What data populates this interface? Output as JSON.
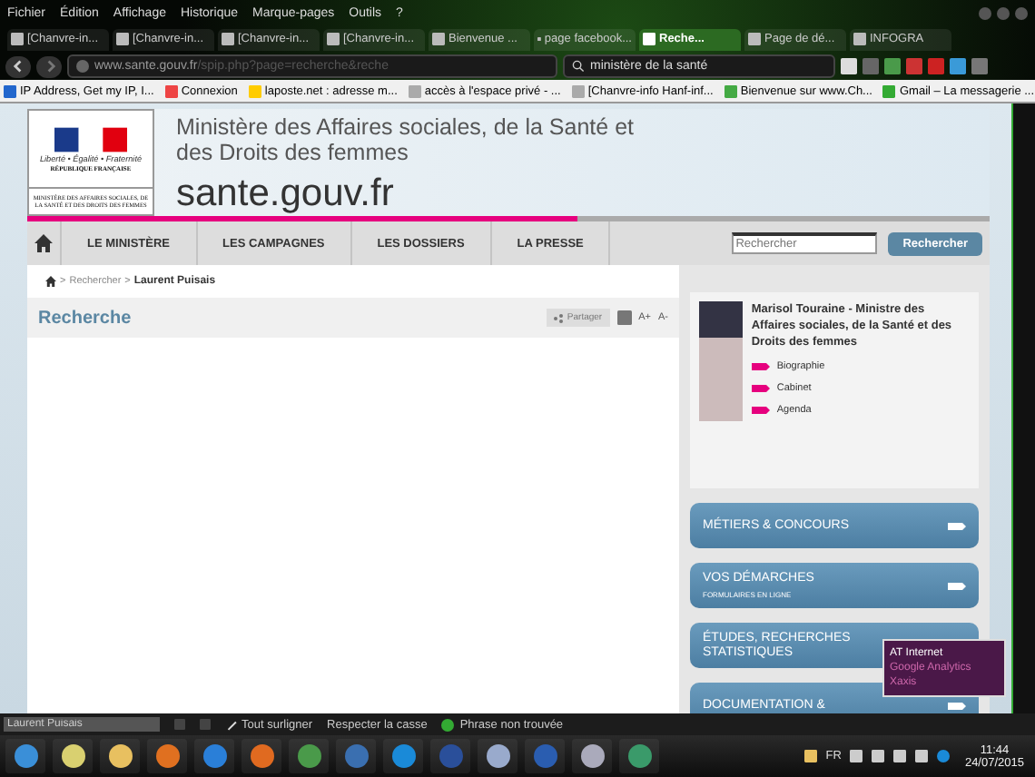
{
  "menu": [
    "Fichier",
    "Édition",
    "Affichage",
    "Historique",
    "Marque-pages",
    "Outils",
    "?"
  ],
  "tabs": [
    {
      "label": "[Chanvre-in...",
      "selected": false
    },
    {
      "label": "[Chanvre-in...",
      "selected": false
    },
    {
      "label": "[Chanvre-in...",
      "selected": false
    },
    {
      "label": "[Chanvre-in...",
      "selected": false
    },
    {
      "label": "Bienvenue ...",
      "selected": false
    },
    {
      "label": "page facebook...",
      "selected": false
    },
    {
      "label": "Reche...",
      "selected": true
    },
    {
      "label": "Page de dé...",
      "selected": false
    },
    {
      "label": "INFOGRA",
      "selected": false
    }
  ],
  "address": {
    "host": "www.sante.gouv.fr",
    "path": "/spip.php?page=recherche&reche"
  },
  "browser_search": {
    "value": "ministère de la santé"
  },
  "bookmarks": [
    "IP Address, Get my IP, I...",
    "Connexion",
    "laposte.net : adresse m...",
    "accès à l'espace privé - ...",
    "[Chanvre-info Hanf-inf...",
    "Bienvenue sur www.Ch...",
    "Gmail – La messagerie ..."
  ],
  "site": {
    "logo_lines": [
      "Liberté • Égalité • Fraternité",
      "RÉPUBLIQUE FRANÇAISE"
    ],
    "logo_ministry": "MINISTÈRE DES AFFAIRES SOCIALES, DE LA SANTÉ ET DES DROITS DES FEMMES",
    "title": "Ministère des Affaires sociales, de la Santé et des Droits des femmes",
    "domain": "sante.gouv.fr"
  },
  "nav": [
    "LE MINISTÈRE",
    "LES CAMPAGNES",
    "LES DOSSIERS",
    "LA PRESSE"
  ],
  "site_search": {
    "placeholder": "Rechercher",
    "button": "Rechercher"
  },
  "breadcrumb": [
    "Rechercher",
    "Laurent Puisais"
  ],
  "breadcrumb_separator": ">",
  "page_title": "Recherche",
  "share": "Partager",
  "font_size": [
    "A+",
    "A-"
  ],
  "minister": {
    "name": "Marisol Touraine - Ministre des Affaires sociales, de la Santé et des Droits des femmes",
    "links": [
      "Biographie",
      "Cabinet",
      "Agenda"
    ]
  },
  "side_buttons": [
    {
      "lines": [
        "MÉTIERS & CONCOURS"
      ]
    },
    {
      "lines": [
        "VOS DÉMARCHES"
      ],
      "subtitle": "FORMULAIRES EN LIGNE"
    },
    {
      "lines": [
        "ÉTUDES, RECHERCHES",
        "STATISTIQUES"
      ]
    },
    {
      "lines": [
        "DOCUMENTATION &"
      ]
    }
  ],
  "tooltip": [
    "AT Internet",
    "Google Analytics",
    "Xaxis"
  ],
  "find_bar": {
    "value": "Laurent Puisais",
    "highlight_all": "Tout surligner",
    "match_case": "Respecter la casse",
    "status": "Phrase non trouvée"
  },
  "taskbar": {
    "language": "FR",
    "time": "11:44",
    "date": "24/07/2015"
  }
}
